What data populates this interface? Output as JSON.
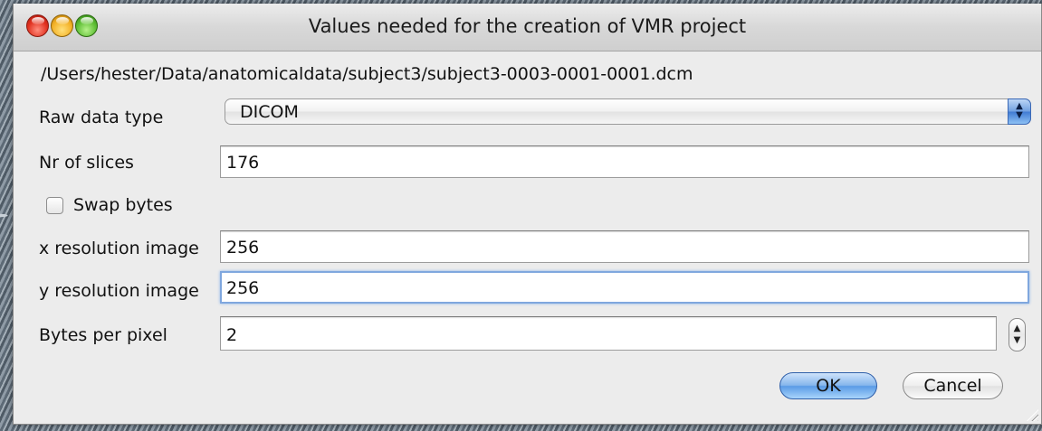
{
  "window": {
    "title": "Values needed for the creation of VMR project"
  },
  "file_path": "/Users/hester/Data/anatomicaldata/subject3/subject3-0003-0001-0001.dcm",
  "form": {
    "raw_data_type": {
      "label": "Raw data type",
      "selected": "DICOM"
    },
    "nr_of_slices": {
      "label": "Nr of slices",
      "value": "176"
    },
    "swap_bytes": {
      "label": "Swap bytes",
      "checked": false
    },
    "x_resolution": {
      "label": "x resolution image",
      "value": "256"
    },
    "y_resolution": {
      "label": "y resolution image",
      "value": "256"
    },
    "bytes_per_pixel": {
      "label": "Bytes per pixel",
      "value": "2"
    }
  },
  "buttons": {
    "ok": "OK",
    "cancel": "Cancel"
  },
  "icons": {
    "close": "close-icon",
    "minimize": "minimize-icon",
    "zoom": "zoom-icon",
    "select_arrows": "updown-arrows-icon",
    "stepper": "stepper-icon",
    "resize_grip": "resize-grip-icon"
  },
  "colors": {
    "default_button": "#5a9be6",
    "focus_ring": "#7fa7de",
    "window_bg": "#ececec"
  }
}
